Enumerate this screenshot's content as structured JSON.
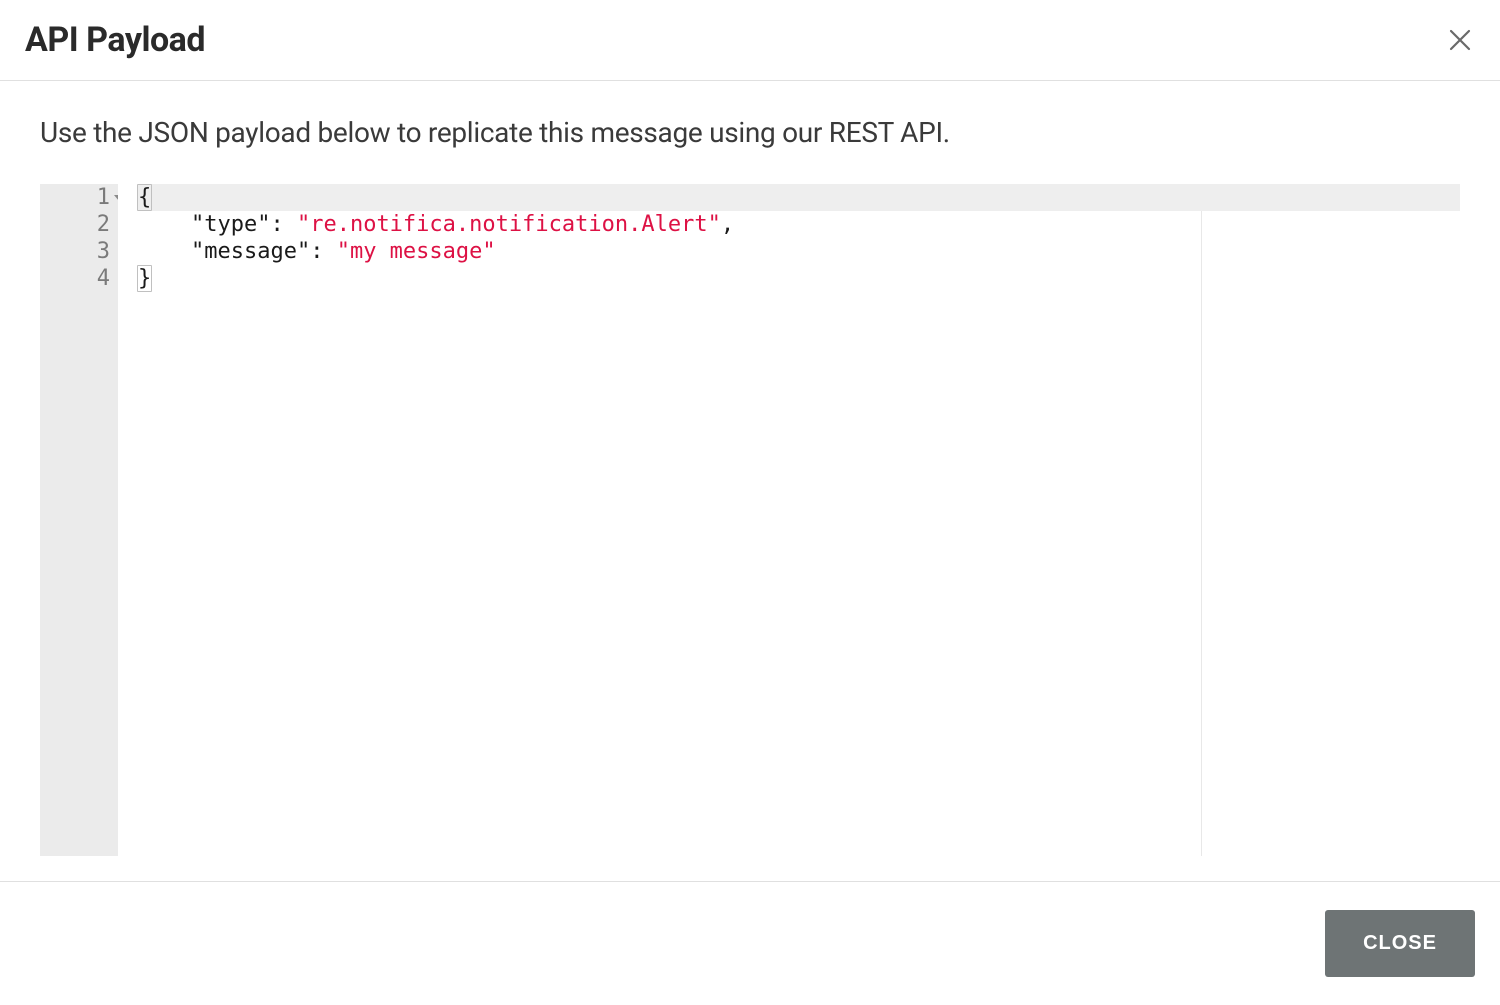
{
  "modal": {
    "title": "API Payload",
    "description": "Use the JSON payload below to replicate this message using our REST API.",
    "close_button_label": "CLOSE"
  },
  "editor": {
    "line_numbers": [
      "1",
      "2",
      "3",
      "4"
    ],
    "active_line_index": 0,
    "code_lines": [
      {
        "tokens": [
          {
            "text": "{",
            "class": "tok-paren bracket-hl"
          }
        ],
        "indent": 0
      },
      {
        "tokens": [
          {
            "text": "\"type\"",
            "class": "tok-key"
          },
          {
            "text": ": ",
            "class": "tok-punct"
          },
          {
            "text": "\"re.notifica.notification.Alert\"",
            "class": "tok-string"
          },
          {
            "text": ",",
            "class": "tok-punct"
          }
        ],
        "indent": 4
      },
      {
        "tokens": [
          {
            "text": "\"message\"",
            "class": "tok-key"
          },
          {
            "text": ": ",
            "class": "tok-punct"
          },
          {
            "text": "\"my message\"",
            "class": "tok-string"
          }
        ],
        "indent": 4
      },
      {
        "tokens": [
          {
            "text": "}",
            "class": "tok-paren bracket-hl"
          }
        ],
        "indent": 0
      }
    ]
  }
}
